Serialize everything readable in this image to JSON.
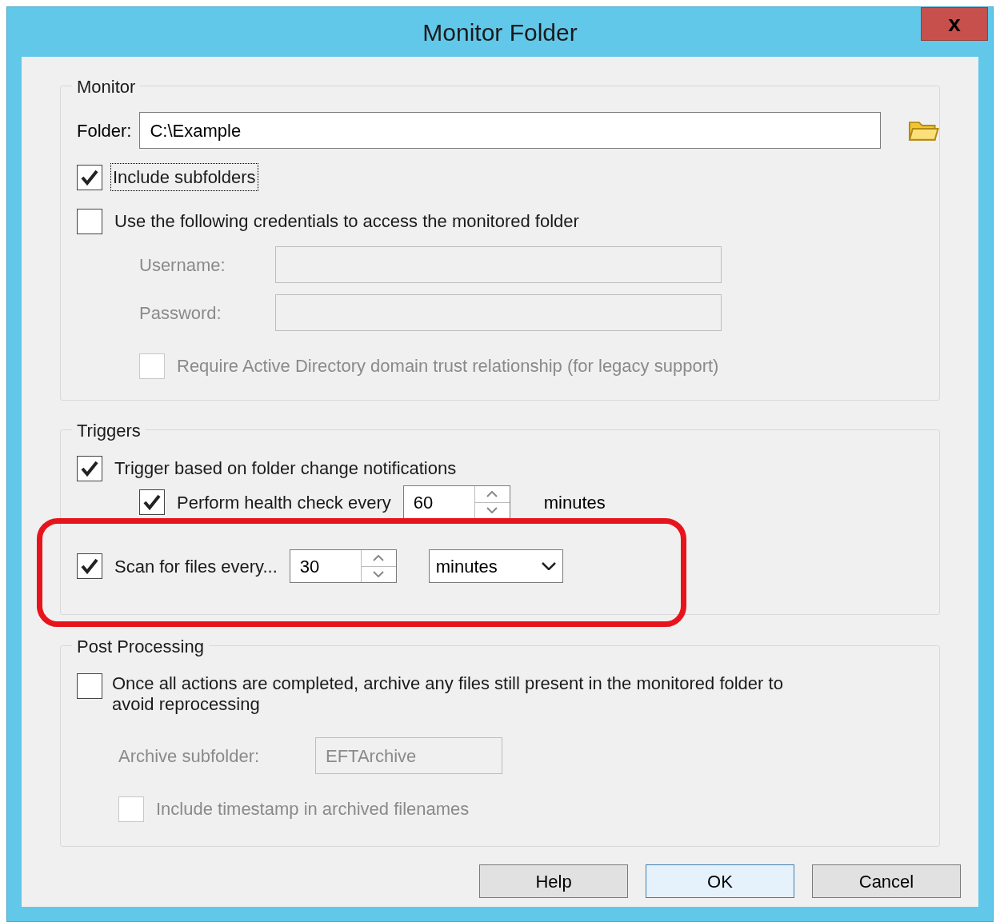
{
  "window": {
    "title": "Monitor Folder",
    "close": "x"
  },
  "monitor": {
    "legend": "Monitor",
    "folder_label": "Folder:",
    "folder_value": "C:\\Example",
    "include_subfolders": {
      "label": "Include subfolders",
      "checked": true,
      "focused": true
    },
    "use_credentials": {
      "label": "Use the following credentials to access the monitored folder",
      "checked": false
    },
    "username": {
      "label": "Username:",
      "disabled": true
    },
    "password": {
      "label": "Password:",
      "disabled": true
    },
    "require_ad": {
      "label": "Require Active Directory domain trust relationship (for legacy support)",
      "checked": false,
      "disabled": true
    }
  },
  "triggers": {
    "legend": "Triggers",
    "change_notifications": {
      "label": "Trigger based on folder change notifications",
      "checked": true
    },
    "health_check": {
      "label": "Perform health check every",
      "checked": true,
      "value": "60",
      "unit": "minutes"
    },
    "scan": {
      "label": "Scan for files every...",
      "checked": true,
      "value": "30",
      "unit": "minutes"
    }
  },
  "post_processing": {
    "legend": "Post Processing",
    "archive": {
      "label": "Once all actions are completed, archive any files still present in the monitored folder to avoid reprocessing",
      "checked": false
    },
    "archive_subfolder": {
      "label": "Archive subfolder:",
      "value": "EFTArchive",
      "disabled": true
    },
    "timestamp": {
      "label": "Include timestamp in archived filenames",
      "checked": false,
      "disabled": true
    }
  },
  "buttons": [
    "Help",
    "OK",
    "Cancel"
  ]
}
